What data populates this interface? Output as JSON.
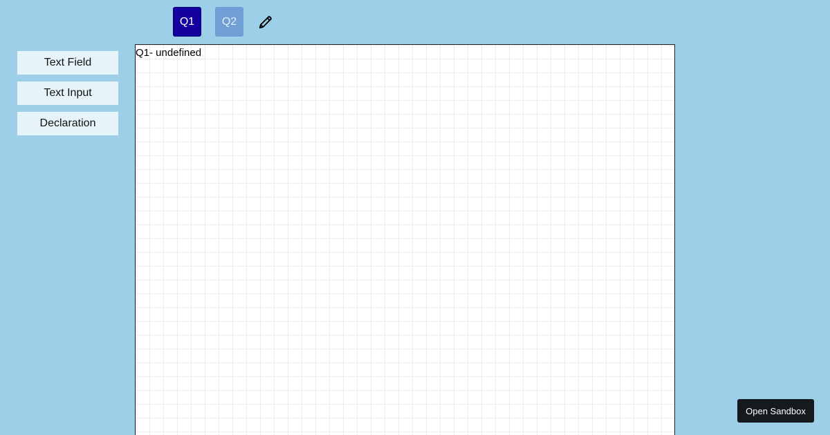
{
  "tabs": [
    {
      "label": "Q1",
      "state": "active",
      "color": "#14009e"
    },
    {
      "label": "Q2",
      "state": "inactive",
      "color": "#6f9fd4"
    }
  ],
  "edit_icon": "pencil-icon",
  "sidebar": {
    "items": [
      {
        "label": "Text Field"
      },
      {
        "label": "Text Input"
      },
      {
        "label": "Declaration"
      }
    ]
  },
  "canvas": {
    "title": "Q1- undefined"
  },
  "sandbox_button": {
    "label": "Open Sandbox"
  },
  "colors": {
    "background": "#9dcfe8",
    "sidebar_button": "#e6f3f9",
    "sandbox_button": "#151a1f"
  }
}
